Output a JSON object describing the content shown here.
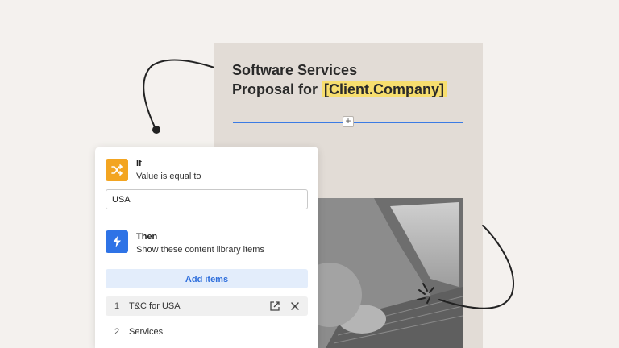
{
  "document": {
    "title_line1": "Software Services",
    "title_line2_prefix": "Proposal for ",
    "title_placeholder": "[Client.Company]"
  },
  "rule": {
    "if_label": "If",
    "if_subtitle": "Value is equal to",
    "value": "USA",
    "then_label": "Then",
    "then_subtitle": "Show these content library items",
    "add_items_label": "Add items",
    "items": [
      {
        "number": "1",
        "label": "T&C for USA"
      },
      {
        "number": "2",
        "label": "Services"
      }
    ]
  },
  "icons": {
    "if_badge": "shuffle-icon",
    "then_badge": "lightning-icon",
    "item_open": "external-link-icon",
    "item_remove": "close-icon",
    "divider_add": "plus-icon"
  },
  "colors": {
    "background": "#f4f1ee",
    "document": "#e2dcd6",
    "highlight": "#f7de6e",
    "if_badge": "#f3a521",
    "then_badge": "#2e73e6",
    "add_button_bg": "#e3edfb",
    "add_button_text": "#2f6fdc",
    "divider": "#3b7be4"
  }
}
